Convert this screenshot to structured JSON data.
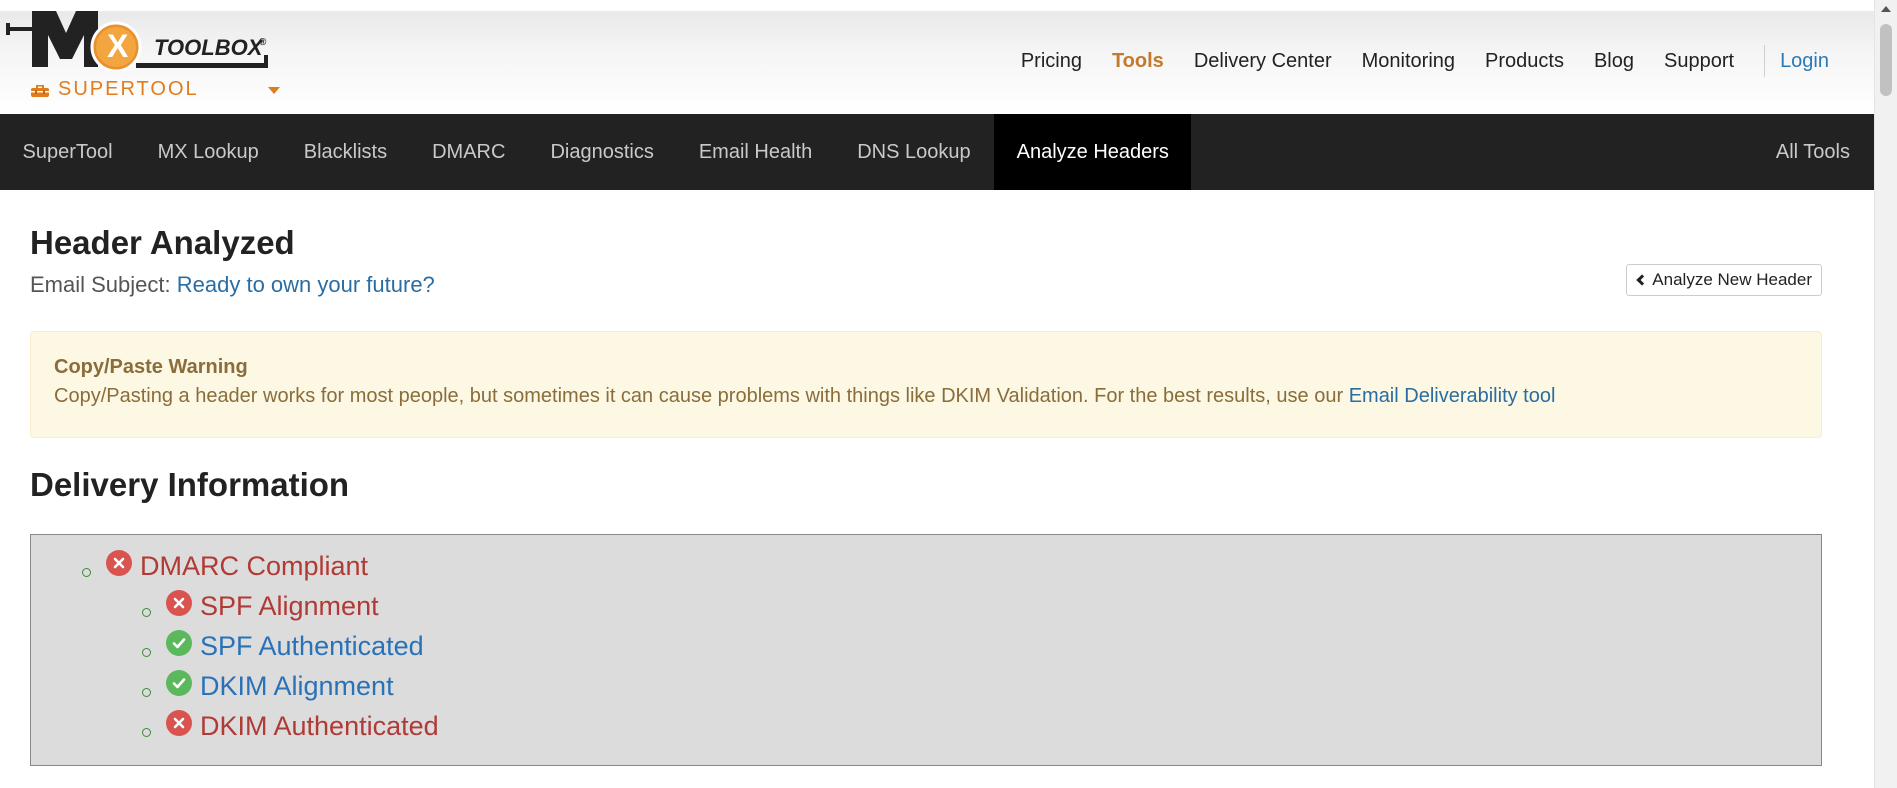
{
  "brand": {
    "logo_letters": "MX",
    "logo_word": "TOOLBOX",
    "supertool_label": "SUPERTOOL",
    "accent_color": "#e07c1a"
  },
  "top_nav": {
    "items": [
      "Pricing",
      "Tools",
      "Delivery Center",
      "Monitoring",
      "Products",
      "Blog",
      "Support"
    ],
    "active": "Tools",
    "login": "Login"
  },
  "tool_tabs": {
    "items": [
      "SuperTool",
      "MX Lookup",
      "Blacklists",
      "DMARC",
      "Diagnostics",
      "Email Health",
      "DNS Lookup",
      "Analyze Headers"
    ],
    "active": "Analyze Headers",
    "all_tools": "All Tools"
  },
  "page": {
    "title": "Header Analyzed",
    "subject_label": "Email Subject:",
    "subject_value": "Ready to own your future?",
    "analyze_new_button": "Analyze New Header"
  },
  "warning": {
    "title": "Copy/Paste Warning",
    "body": "Copy/Pasting a header works for most people, but sometimes it can cause problems with things like DKIM Validation. For the best results, use our ",
    "link": "Email Deliverability tool"
  },
  "delivery": {
    "title": "Delivery Information",
    "items": [
      {
        "label": "DMARC Compliant",
        "status": "fail",
        "icon": "x-circle-icon"
      },
      {
        "label": "SPF Alignment",
        "status": "fail",
        "icon": "x-circle-icon"
      },
      {
        "label": "SPF Authenticated",
        "status": "pass",
        "icon": "check-circle-icon"
      },
      {
        "label": "DKIM Alignment",
        "status": "pass",
        "icon": "check-circle-icon"
      },
      {
        "label": "DKIM Authenticated",
        "status": "fail",
        "icon": "x-circle-icon"
      }
    ],
    "fail_color": "#d9534f",
    "pass_color": "#5cb85c"
  }
}
